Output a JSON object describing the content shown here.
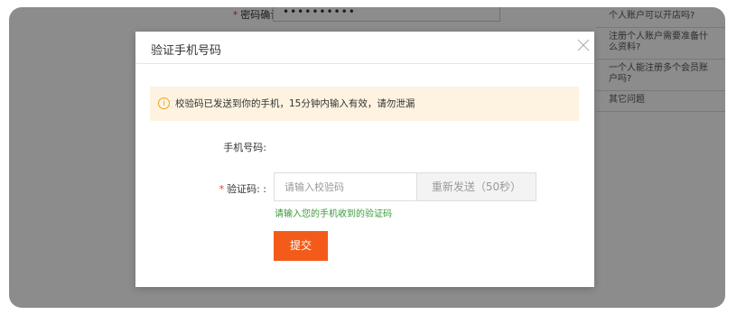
{
  "background": {
    "confirm_password_label": "密码确认:",
    "confirm_password_value": "••••••••••",
    "faq_items": [
      "个人账户可以开店吗?",
      "注册个人账户需要准备什么资料?",
      "一个人能注册多个会员账户吗?",
      "其它问题"
    ]
  },
  "modal": {
    "title": "验证手机号码",
    "close_symbol": "╳",
    "notice_icon": "i",
    "notice_text": "校验码已发送到你的手机，15分钟内输入有效，请勿泄漏",
    "phone_label": "手机号码:",
    "required_mark": "*",
    "code_label": "验证码: :",
    "code_placeholder": "请输入校验码",
    "resend_label": "重新发送（50秒）",
    "hint": "请输入您的手机收到的验证码",
    "submit_label": "提交"
  },
  "colors": {
    "accent": "#f45b1a",
    "notice_bg": "#fdf3e0",
    "hint": "#3a9a3a",
    "required": "#e4393c"
  }
}
